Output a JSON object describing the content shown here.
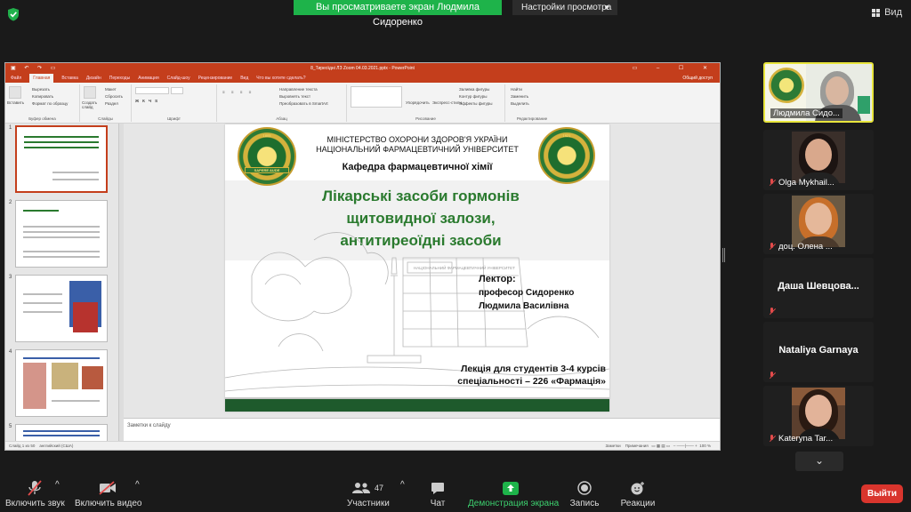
{
  "top": {
    "viewing_banner": "Вы просматриваете экран Людмила Сидоренко",
    "view_options": "Настройки просмотра",
    "view_button": "Вид"
  },
  "ppt": {
    "title": "8_Тиреоїдні ЛЗ Zoom 04.03.2021.pptx - PowerPoint",
    "tabs": [
      "Файл",
      "Главная",
      "Вставка",
      "Дизайн",
      "Переходы",
      "Анимация",
      "Слайд-шоу",
      "Рецензирование",
      "Вид",
      "Что вы хотите сделать?"
    ],
    "active_tab": "Главная",
    "share": "Общий доступ",
    "ribbon_groups": [
      "Буфер обмена",
      "Слайды",
      "Шрифт",
      "Абзац",
      "Рисование",
      "Редактирование"
    ],
    "ribbon_items": {
      "paste": "Вставить",
      "cut": "Вырезать",
      "copy": "Копировать",
      "format": "Формат по образцу",
      "new_slide": "Создать слайд",
      "layout": "Макет",
      "reset": "Сбросить",
      "section": "Раздел",
      "text_dir": "Направление текста",
      "align_text": "Выровнять текст",
      "smartart": "Преобразовать в SmartArt",
      "arrange": "Упорядочить",
      "quick_styles": "Экспресс-стили",
      "shape_fill": "Заливка фигуры",
      "shape_outline": "Контур фигуры",
      "shape_effects": "Эффекты фигуры",
      "find": "Найти",
      "replace": "Заменить",
      "select": "Выделить"
    },
    "thumb_numbers": [
      "1",
      "2",
      "3",
      "4",
      "5"
    ],
    "notes_placeholder": "Заметки к слайду",
    "status_left": "Слайд 1 из 50",
    "status_lang": "английский (США)",
    "status_notes": "Заметки",
    "status_comments": "Примечания",
    "zoom": "100 %"
  },
  "slide": {
    "ministry_line1": "МІНІСТЕРСТВО ОХОРОНИ ЗДОРОВ'Я УКРАЇНИ",
    "ministry_line2": "НАЦІОНАЛЬНИЙ ФАРМАЦЕВТИЧНИЙ УНІВЕРСИТЕТ",
    "department": "Кафедра фармацевтичної хімії",
    "title_line1": "Лікарські засоби гормонів",
    "title_line2": "щитовидної залози,",
    "title_line3": "антитиреоїдні засоби",
    "lector_label": "Лектор:",
    "lector_name1": "професор Сидоренко",
    "lector_name2": "Людмила Василівна",
    "audience_line1": "Лекція для студентів 3-4  курсів",
    "audience_line2": "спеціальності – 226 «Фармація»",
    "seal_left_year": "1805",
    "seal_left_ribbon": "SAPERE AUDE",
    "seal_right_year": "1921",
    "building_sign": "НАЦІОНАЛЬНИЙ ФАРМАЦЕВТИЧНИЙ УНІВЕРСИТЕТ"
  },
  "participants": [
    {
      "name": "Людмила Сидо...",
      "muted": false,
      "video": true
    },
    {
      "name": "Olga Mykhail...",
      "muted": true,
      "video": true
    },
    {
      "name": "доц. Олена ...",
      "muted": true,
      "video": true
    },
    {
      "name": "Даша  Шевцова...",
      "muted": true,
      "video": false
    },
    {
      "name": "Nataliya Garnaya",
      "muted": true,
      "video": false
    },
    {
      "name": "Kateryna Tar...",
      "muted": true,
      "video": true
    }
  ],
  "toolbar": {
    "mute": "Включить звук",
    "video": "Включить видео",
    "participants": "Участники",
    "participants_count": "47",
    "chat": "Чат",
    "share": "Демонстрация экрана",
    "record": "Запись",
    "reactions": "Реакции",
    "leave": "Выйти"
  },
  "colors": {
    "ppt_accent": "#c43e1c",
    "zoom_green": "#1eb34a",
    "slide_title_green": "#2a7a2e",
    "leave_red": "#d9352d"
  }
}
